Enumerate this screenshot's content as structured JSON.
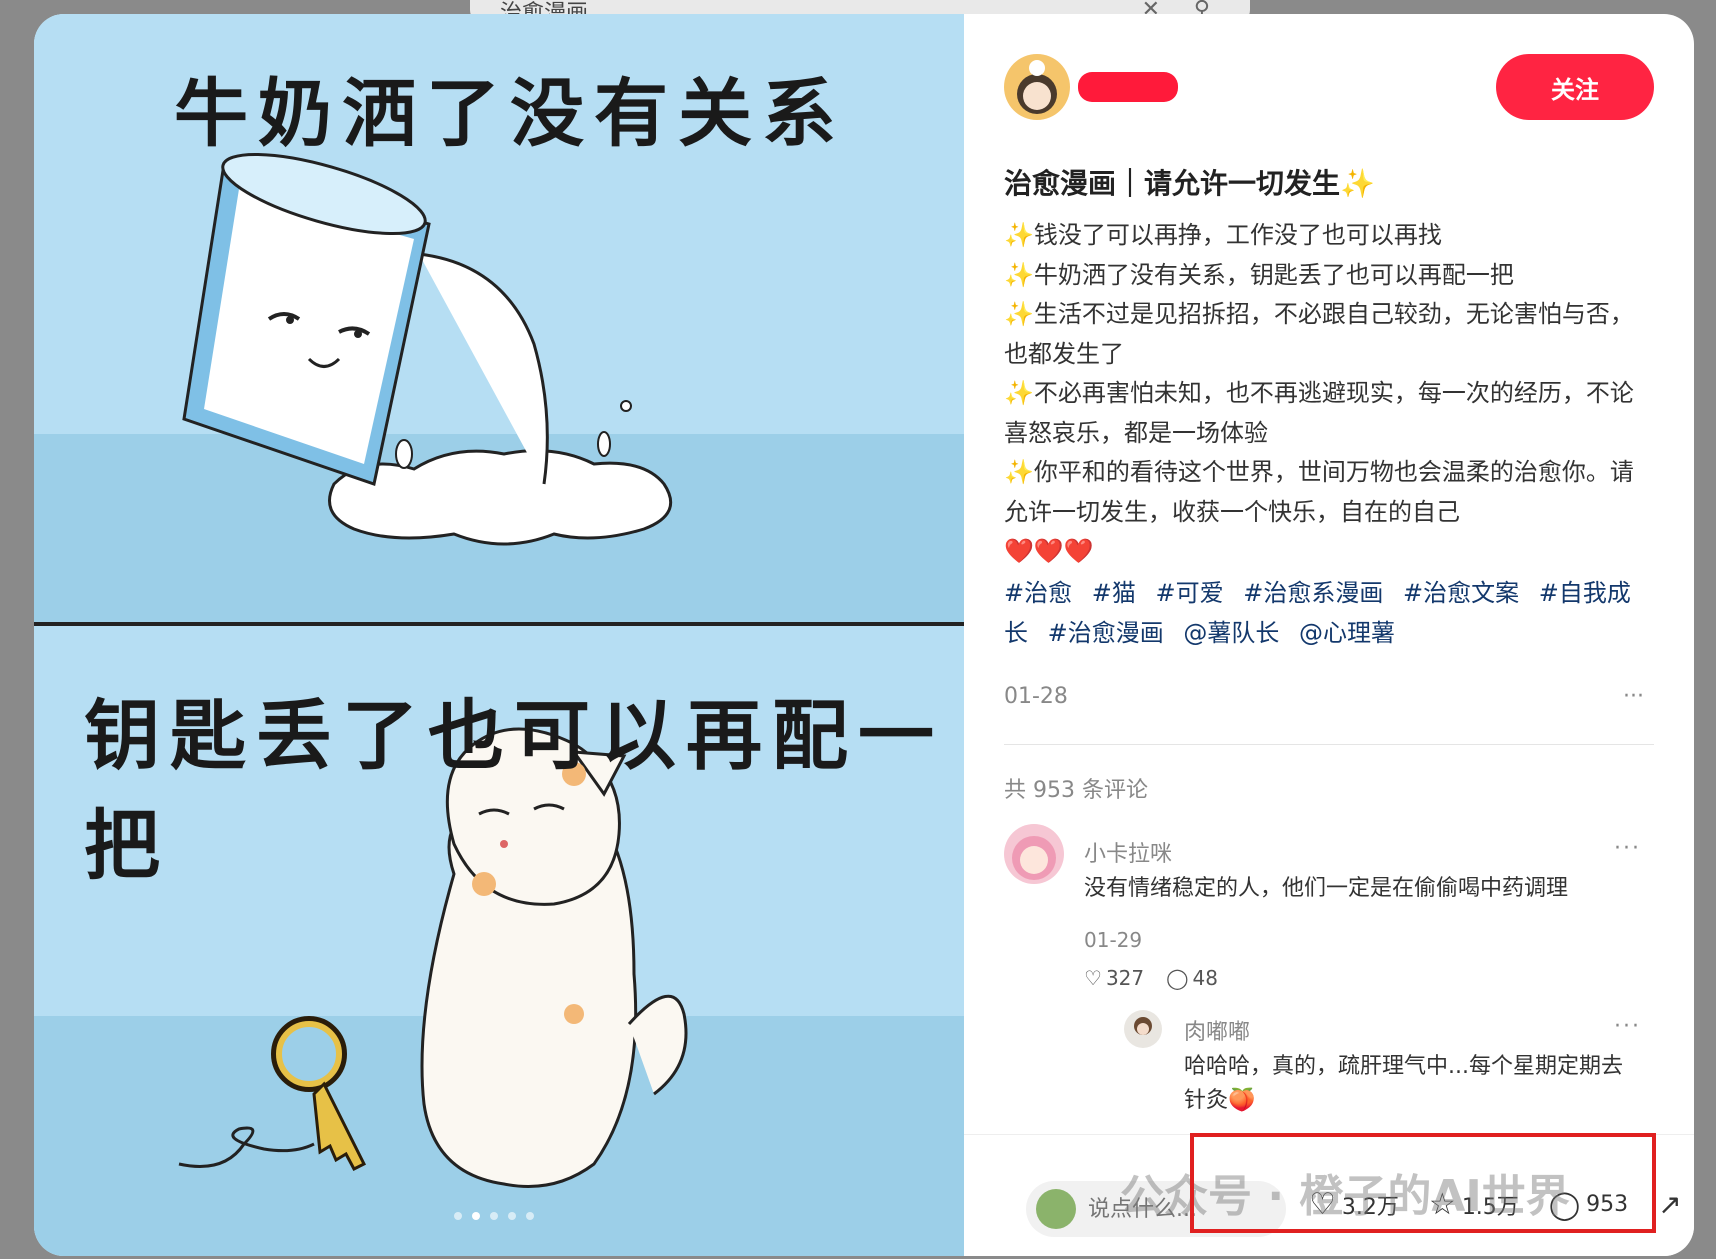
{
  "background": {
    "search_text": "治愈漫画"
  },
  "post": {
    "image_text_top": "牛奶洒了没有关系",
    "image_text_bottom": "钥匙丢了也可以再配一把",
    "carousel_total": 5,
    "carousel_active": 2
  },
  "author": {
    "follow_label": "关注"
  },
  "note": {
    "title": "治愈漫画｜请允许一切发生✨",
    "lines": [
      "✨钱没了可以再挣，工作没了也可以再找",
      "✨牛奶洒了没有关系，钥匙丢了也可以再配一把",
      "✨生活不过是见招拆招，不必跟自己较劲，无论害怕与否，也都发生了",
      "✨不必再害怕未知，也不再逃避现实，每一次的经历，不论喜怒哀乐，都是一场体验",
      "✨你平和的看待这个世界，世间万物也会温柔的治愈你。请允许一切发生，收获一个快乐，自在的自己",
      "❤️❤️❤️"
    ],
    "tags": [
      "#治愈",
      "#猫",
      "#可爱",
      "#治愈系漫画",
      "#治愈文案",
      "#自我成长",
      "#治愈漫画",
      "@薯队长",
      "@心理薯"
    ],
    "date": "01-28",
    "more": "···"
  },
  "comments": {
    "count_text": "共 953 条评论",
    "main": {
      "name": "小卡拉咪",
      "text": "没有情绪稳定的人，他们一定是在偷偷喝中药调理",
      "date": "01-29",
      "likes": "327",
      "replies": "48"
    },
    "reply": {
      "name": "肉嘟嘟",
      "text": "哈哈哈，真的，疏肝理气中...每个星期定期去针灸🍑"
    }
  },
  "bottom_bar": {
    "placeholder": "说点什么...",
    "likes": "3.2万",
    "collects": "1.5万",
    "comments": "953"
  },
  "overlay": {
    "watermark": "公众号 · 橙子的AI世界"
  },
  "colors": {
    "accent": "#ff2442",
    "tag": "#13386c",
    "sky": "#a8d6ee",
    "highlight": "#e02020"
  }
}
